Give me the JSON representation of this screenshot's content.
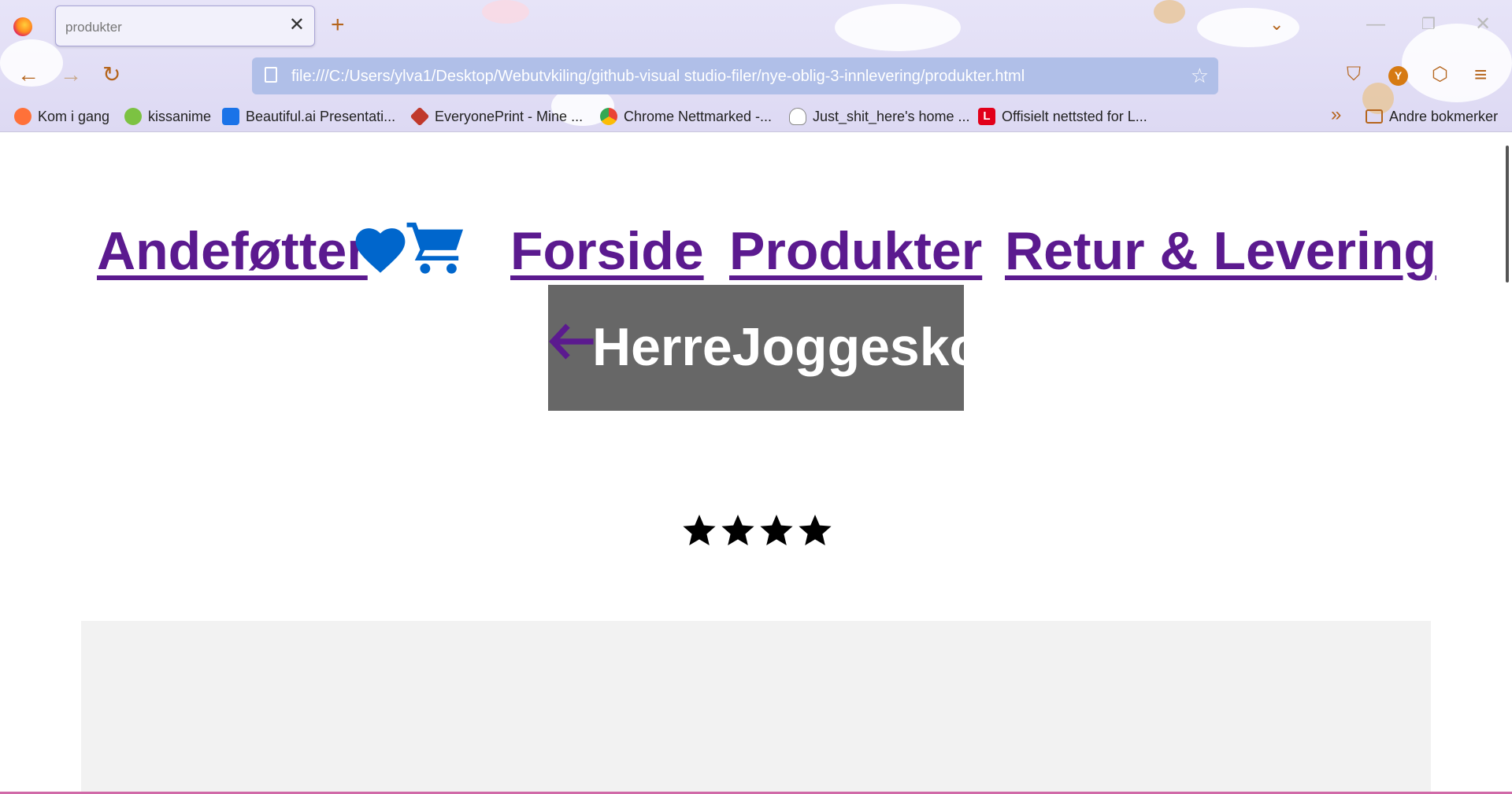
{
  "browser": {
    "tab": {
      "title": "produkter",
      "close_glyph": "✕"
    },
    "new_tab_glyph": "+",
    "list_tabs_glyph": "⌄",
    "window": {
      "minimize": "—",
      "restore": "❐",
      "close": "✕"
    },
    "nav": {
      "back": "←",
      "forward": "→",
      "reload": "↻"
    },
    "url": "file:///C:/Users/ylva1/Desktop/Webutvkiling/github-visual studio-filer/nye-oblig-3-innlevering/produkter.html",
    "bookmark_star": "☆",
    "toolbar": {
      "pocket": "⛉",
      "avatar_letter": "Y",
      "extensions": "⬡",
      "menu": "≡"
    },
    "bookmarks": [
      {
        "label": "Kom i gang",
        "icon": "firefox-icon",
        "color": "#ff7139"
      },
      {
        "label": "kissanime",
        "icon": "kissanime-icon",
        "color": "#7cc242"
      },
      {
        "label": "Beautiful.ai Presentati...",
        "icon": "beautiful-ai-icon",
        "color": "#1a73e8"
      },
      {
        "label": "EveryonePrint - Mine ...",
        "icon": "everyoneprint-icon",
        "color": "#c0392b"
      },
      {
        "label": "Chrome Nettmarked -...",
        "icon": "chrome-webstore-icon",
        "color": "#34a853"
      },
      {
        "label": "Just_shit_here's home ...",
        "icon": "ghost-icon",
        "color": "#ffffff"
      },
      {
        "label": "Offisielt nettsted for L...",
        "icon": "l-logo-icon",
        "color": "#e2001a"
      }
    ],
    "bookmarks_more_glyph": "»",
    "other_bookmarks": {
      "label": "Andre bokmerker",
      "icon": "folder-icon"
    }
  },
  "site": {
    "brand": "Andeføtter",
    "nav": [
      {
        "label": "Forside"
      },
      {
        "label": "Produkter"
      },
      {
        "label": "Retur & Levering"
      }
    ],
    "page_title": "HerreJoggesko",
    "rating": {
      "stars": 4,
      "max_shown": 4
    },
    "colors": {
      "link": "#5b1a8f",
      "heart": "#0066cc",
      "cart": "#0066cc",
      "title_bg": "#676767",
      "panel_bg": "#f2f2f2"
    }
  }
}
